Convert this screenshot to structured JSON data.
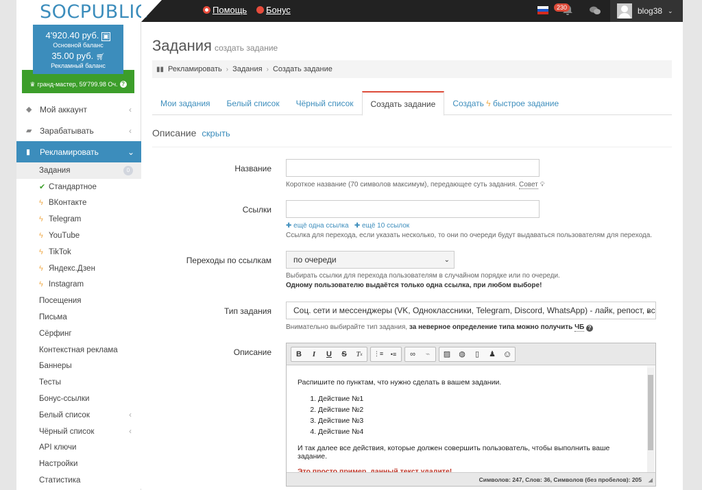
{
  "header": {
    "logo_a": "SOC",
    "logo_b": "PUBLIC",
    "help": "Помощь",
    "bonus": "Бонус",
    "notifications": "230",
    "username": "blog38"
  },
  "balance": {
    "main_amount": "4'920.40 руб.",
    "main_label": "Основной баланс",
    "ad_amount": "35.00 руб.",
    "ad_label": "Рекламный баланс",
    "rank": "гранд-мастер, 59'799.98 Оч."
  },
  "sidebar": {
    "items": [
      {
        "label": "Мой аккаунт"
      },
      {
        "label": "Зарабатывать"
      },
      {
        "label": "Рекламировать"
      }
    ],
    "sub": [
      {
        "label": "Задания",
        "badge": "0"
      },
      {
        "label": "Стандартное"
      },
      {
        "label": "ВКонтакте"
      },
      {
        "label": "Telegram"
      },
      {
        "label": "YouTube"
      },
      {
        "label": "TikTok"
      },
      {
        "label": "Яндекс.Дзен"
      },
      {
        "label": "Instagram"
      },
      {
        "label": "Посещения"
      },
      {
        "label": "Письма"
      },
      {
        "label": "Сёрфинг"
      },
      {
        "label": "Контекстная реклама"
      },
      {
        "label": "Баннеры"
      },
      {
        "label": "Тесты"
      },
      {
        "label": "Бонус-ссылки"
      },
      {
        "label": "Белый список"
      },
      {
        "label": "Чёрный список"
      },
      {
        "label": "API ключи"
      },
      {
        "label": "Настройки"
      },
      {
        "label": "Статистика"
      }
    ]
  },
  "page": {
    "title": "Задания",
    "subtitle": "создать задание",
    "breadcrumb": [
      "Рекламировать",
      "Задания",
      "Создать задание"
    ],
    "tabs": [
      "Мои задания",
      "Белый список",
      "Чёрный список",
      "Создать задание",
      "Создать",
      "быстрое задание"
    ],
    "section": "Описание",
    "section_toggle": "скрыть"
  },
  "form": {
    "name_label": "Название",
    "name_help": "Короткое название (70 символов максимум), передающее суть задания.",
    "name_tip": "Совет",
    "links_label": "Ссылки",
    "links_add1": "ещё одна ссылка",
    "links_add10": "ещё 10 ссылок",
    "links_help": "Ссылка для перехода, если указать несколько, то они по очереди будут выдаваться пользователям для перехода.",
    "transitions_label": "Переходы по ссылкам",
    "transitions_value": "по очереди",
    "transitions_help": "Выбирать ссылки для перехода пользователям в случайном порядке или по очереди.",
    "transitions_help_bold": "Одному пользователю выдаётся только одна ссылка, при любом выборе!",
    "type_label": "Тип задания",
    "type_value": "Соц. сети и мессенджеры (VK, Одноклассники, Telegram, Discord, WhatsApp) - лайк, репост, вступ",
    "type_help": "Внимательно выбирайте тип задания,",
    "type_help_bold": "за неверное определение типа можно получить",
    "type_help_abbr": "ЧБ",
    "desc_label": "Описание"
  },
  "editor": {
    "intro": "Распишите по пунктам, что нужно сделать в вашем задании.",
    "steps": [
      "Действие №1",
      "Действие №2",
      "Действие №3",
      "Действие №4"
    ],
    "outro": "И так далее все действия, которые должен совершить пользователь, чтобы выполнить ваше задание.",
    "note": "Это просто пример, данный текст удалите!",
    "status": "Символов: 247, Слов: 36, Символов (без пробелов): 205"
  }
}
